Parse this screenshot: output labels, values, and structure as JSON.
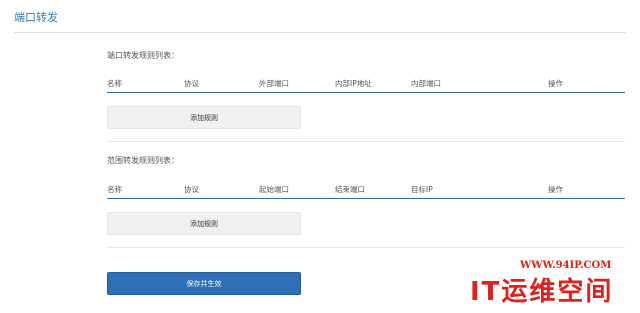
{
  "page": {
    "title": "端口转发"
  },
  "port_rules": {
    "heading": "端口转发规则列表：",
    "columns": [
      "名称",
      "协议",
      "外部端口",
      "内部IP地址",
      "内部端口",
      "操作"
    ],
    "add_label": "添加规则"
  },
  "range_rules": {
    "heading": "范围转发规则列表：",
    "columns": [
      "名称",
      "协议",
      "起始端口",
      "结束端口",
      "目标IP",
      "操作"
    ],
    "add_label": "添加规则"
  },
  "actions": {
    "save_label": "保存并生效"
  },
  "watermark": {
    "url": "WWW.94IP.COM",
    "brand": "IT运维空间"
  },
  "colors": {
    "accent": "#2e6fb7",
    "title": "#2f7ab8",
    "watermark": "#e0201c"
  }
}
